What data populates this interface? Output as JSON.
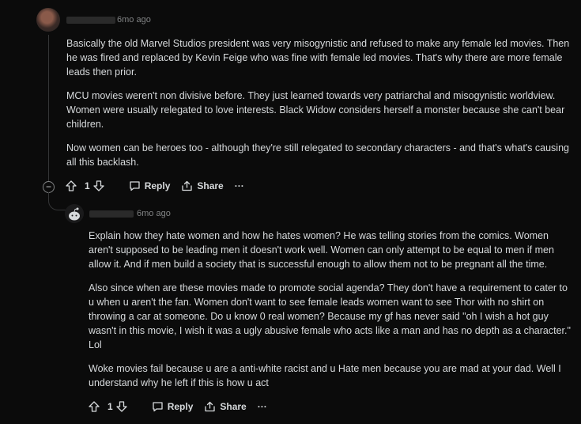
{
  "comment1": {
    "age": "6mo ago",
    "paragraphs": [
      "Basically the old Marvel Studios president was very misogynistic and refused to make any female led movies. Then he was fired and replaced by Kevin Feige who was fine with female led movies. That's why there are more female leads then prior.",
      "MCU movies weren't non divisive before. They just learned towards very patriarchal and misogynistic worldview. Women were usually relegated to love interests. Black Widow considers herself a monster because she can't bear children.",
      "Now women can be heroes too - although they're still relegated to secondary characters - and that's what's causing all this backlash."
    ],
    "votes": "1",
    "reply_label": "Reply",
    "share_label": "Share",
    "more_label": "···",
    "collapse_label": "−"
  },
  "comment2": {
    "age": "6mo ago",
    "paragraphs": [
      "Explain how they hate women and how he hates women? He was telling stories from the comics. Women aren't supposed to be leading men it doesn't work well. Women can only attempt to be equal to men if men allow it. And if men build a society that is successful enough to allow them not to be pregnant all the time.",
      "Also since when are these movies made to promote social agenda? They don't have a requirement to cater to u when u aren't the fan. Women don't want to see female leads women want to see Thor with no shirt on throwing a car at someone. Do u know 0 real women? Because my gf has never said \"oh I wish a hot guy wasn't in this movie, I wish it was a ugly abusive female who acts like a man and has no depth as a character.\" Lol",
      "Woke movies fail because u are a anti-white racist and u Hate men because you are mad at your dad. Well I understand why he left if this is how u act"
    ],
    "votes": "1",
    "reply_label": "Reply",
    "share_label": "Share",
    "more_label": "···"
  },
  "icons": [
    "upvote-icon",
    "downvote-icon",
    "reply-icon",
    "share-icon",
    "more-icon",
    "collapse-icon",
    "avatar"
  ]
}
